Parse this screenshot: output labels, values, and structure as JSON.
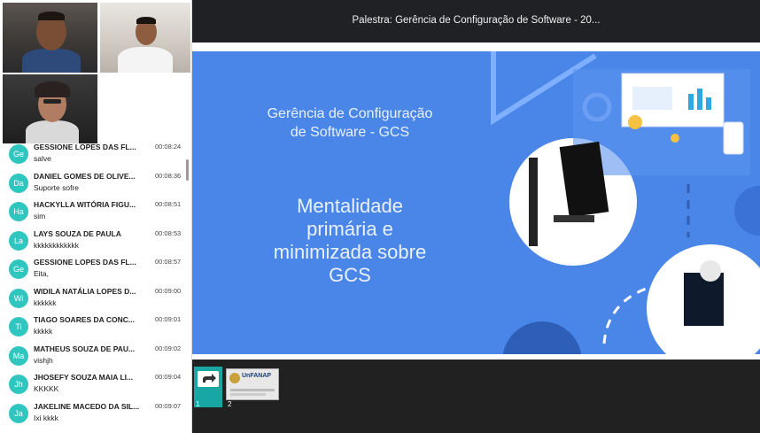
{
  "window": {
    "title": "Palestra: Gerência de Configuração de Software - 20..."
  },
  "slide": {
    "title_line1": "Gerência de Configuração",
    "title_line2": "de Software - GCS",
    "subtitle_line1": "Mentalidade",
    "subtitle_line2": "primária e",
    "subtitle_line3": "minimizada sobre",
    "subtitle_line4": "GCS",
    "background_color": "#4a86e8"
  },
  "thumbnails": [
    {
      "number": "1"
    },
    {
      "number": "2",
      "logo_text": "UnFANAP"
    }
  ],
  "chat": {
    "messages": [
      {
        "initials": "Ge",
        "name": "GESSIONE LOPES DAS FL...",
        "time": "00:08:24",
        "text": "salve"
      },
      {
        "initials": "Da",
        "name": "DANIEL GOMES DE OLIVE...",
        "time": "00:08:36",
        "text": "Suporte sofre"
      },
      {
        "initials": "Ha",
        "name": "HACKYLLA WITÓRIA FIGU...",
        "time": "00:08:51",
        "text": "sim"
      },
      {
        "initials": "La",
        "name": "LAYS SOUZA DE PAULA",
        "time": "00:08:53",
        "text": "kkkkkkkkkkkk"
      },
      {
        "initials": "Ge",
        "name": "GESSIONE LOPES DAS FL...",
        "time": "00:08:57",
        "text": "Eita,"
      },
      {
        "initials": "Wi",
        "name": "WIDILA NATÁLIA LOPES D...",
        "time": "00:09:00",
        "text": "kkkkkk"
      },
      {
        "initials": "Ti",
        "name": "TIAGO SOARES DA CONC...",
        "time": "00:09:01",
        "text": "kkkkk"
      },
      {
        "initials": "Ma",
        "name": "MATHEUS SOUZA DE PAU...",
        "time": "00:09:02",
        "text": "vishjh"
      },
      {
        "initials": "Jh",
        "name": "JHOSEFY SOUZA MAIA LI...",
        "time": "00:09:04",
        "text": "KKKKK"
      },
      {
        "initials": "Ja",
        "name": "JAKELINE MACEDO DA SIL...",
        "time": "00:09:07",
        "text": "Ixi kkkk"
      }
    ],
    "avatar_color": "#2fc6c0"
  }
}
